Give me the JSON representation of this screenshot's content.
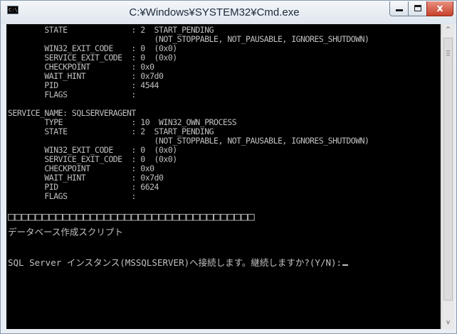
{
  "window": {
    "title": "C:¥Windows¥SYSTEM32¥Cmd.exe",
    "icon_label": "C:\\",
    "controls": {
      "minimize": "minimize-icon",
      "maximize": "maximize-icon",
      "close": "x"
    }
  },
  "console": {
    "lines": [
      "        STATE              : 2  START_PENDING",
      "                                (NOT_STOPPABLE, NOT_PAUSABLE, IGNORES_SHUTDOWN)",
      "        WIN32_EXIT_CODE    : 0  (0x0)",
      "        SERVICE_EXIT_CODE  : 0  (0x0)",
      "        CHECKPOINT         : 0x0",
      "        WAIT_HINT          : 0x7d0",
      "        PID                : 4544",
      "        FLAGS              :",
      "",
      "SERVICE_NAME: SQLSERVERAGENT",
      "        TYPE               : 10  WIN32_OWN_PROCESS",
      "        STATE              : 2  START_PENDING",
      "                                (NOT_STOPPABLE, NOT_PAUSABLE, IGNORES_SHUTDOWN)",
      "        WIN32_EXIT_CODE    : 0  (0x0)",
      "        SERVICE_EXIT_CODE  : 0  (0x0)",
      "        CHECKPOINT         : 0x0",
      "        WAIT_HINT          : 0x7d0",
      "        PID                : 6624",
      "        FLAGS              :",
      "",
      "□□□□□□□□□□□□□□□□□□□□□□□□□□□□□□□□□□□□",
      "データベース作成スクリプト",
      "",
      "SQL Server インスタンス(MSSQLSERVER)へ接続します。継続しますか?(Y/N):"
    ]
  },
  "scrollbar": {
    "up_arrow": "^",
    "down_arrow": "v"
  }
}
